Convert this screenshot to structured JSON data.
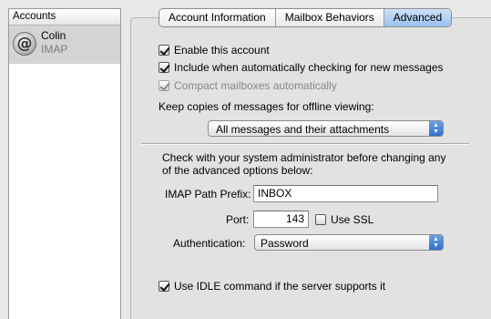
{
  "sidebar": {
    "header": "Accounts",
    "accounts": [
      {
        "name": "Colin",
        "type": "IMAP",
        "icon": "at-sign-icon"
      }
    ]
  },
  "tabs": [
    {
      "label": "Account Information",
      "active": false
    },
    {
      "label": "Mailbox Behaviors",
      "active": false
    },
    {
      "label": "Advanced",
      "active": true
    }
  ],
  "options": {
    "enable_account": {
      "label": "Enable this account",
      "checked": true
    },
    "include_checking": {
      "label": "Include when automatically checking for new messages",
      "checked": true
    },
    "compact_mailboxes": {
      "label": "Compact mailboxes automatically",
      "checked": true,
      "enabled": false
    },
    "keep_copies_label": "Keep copies of messages for offline viewing:",
    "keep_copies_value": "All messages and their attachments"
  },
  "advanced": {
    "note": "Check with your system administrator before changing any of the advanced options below:",
    "imap_path_label": "IMAP Path Prefix:",
    "imap_path_value": "INBOX",
    "port_label": "Port:",
    "port_value": "143",
    "use_ssl": {
      "label": "Use SSL",
      "checked": false
    },
    "auth_label": "Authentication:",
    "auth_value": "Password",
    "idle": {
      "label": "Use IDLE command if the server supports it",
      "checked": true
    }
  },
  "colors": {
    "accent": "#98c1ef",
    "popup_arrow": "#2f6fd1",
    "selection": "#d4d4d4"
  }
}
